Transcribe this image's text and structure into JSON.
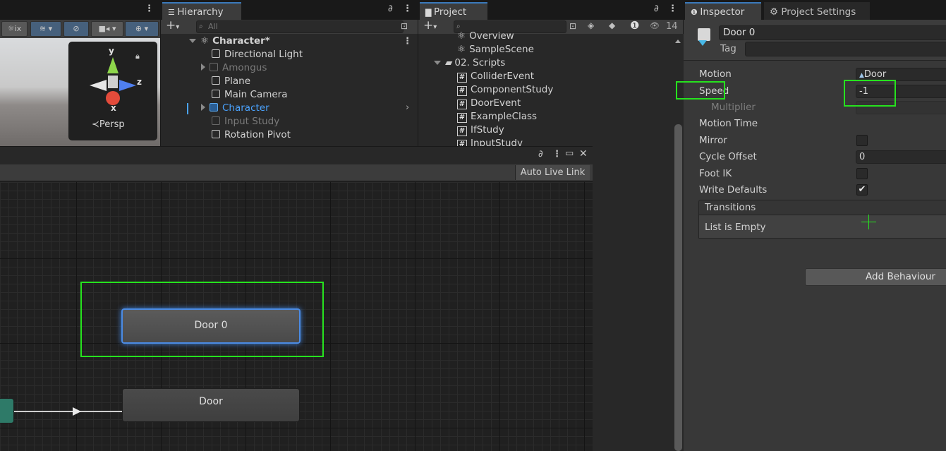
{
  "hierarchy": {
    "tab_label": "Hierarchy",
    "search_placeholder": "All",
    "items": [
      {
        "label": "Character*",
        "style": "root"
      },
      {
        "label": "Directional Light",
        "style": "normal"
      },
      {
        "label": "Amongus",
        "style": "dim"
      },
      {
        "label": "Plane",
        "style": "normal"
      },
      {
        "label": "Main Camera",
        "style": "normal"
      },
      {
        "label": "Character",
        "style": "selected"
      },
      {
        "label": "Input Study",
        "style": "dim"
      },
      {
        "label": "Rotation Pivot",
        "style": "normal"
      }
    ]
  },
  "project": {
    "tab_label": "Project",
    "hidden_count": "14",
    "items": [
      {
        "label": "Overview",
        "type": "scene"
      },
      {
        "label": "SampleScene",
        "type": "scene"
      },
      {
        "label": "02. Scripts",
        "type": "folder"
      },
      {
        "label": "ColliderEvent",
        "type": "script"
      },
      {
        "label": "ComponentStudy",
        "type": "script"
      },
      {
        "label": "DoorEvent",
        "type": "script"
      },
      {
        "label": "ExampleClass",
        "type": "script"
      },
      {
        "label": "IfStudy",
        "type": "script"
      },
      {
        "label": "InputStudy",
        "type": "script"
      }
    ]
  },
  "scene_view": {
    "gizmo_y": "y",
    "gizmo_x": "x",
    "gizmo_z": "z",
    "persp_label": "≺Persp"
  },
  "animator": {
    "auto_live_link": "Auto Live Link",
    "node_selected": "Door 0",
    "node_default": "Door"
  },
  "inspector": {
    "tab_label": "Inspector",
    "project_settings_label": "Project Settings",
    "object_name": "Door 0",
    "tag_label": "Tag",
    "motion_label": "Motion",
    "motion_value": "Door",
    "speed_label": "Speed",
    "speed_value": "-1",
    "multiplier_label": "Multiplier",
    "motion_time_label": "Motion Time",
    "mirror_label": "Mirror",
    "cycle_offset_label": "Cycle Offset",
    "cycle_offset_value": "0",
    "foot_ik_label": "Foot IK",
    "write_defaults_label": "Write Defaults",
    "write_defaults_check": "✔",
    "transitions_label": "Transitions",
    "list_empty_label": "List is Empty",
    "add_behaviour_label": "Add Behaviour"
  },
  "colors": {
    "highlight_green": "#26e21e",
    "selection_blue": "#4aa3ff"
  }
}
